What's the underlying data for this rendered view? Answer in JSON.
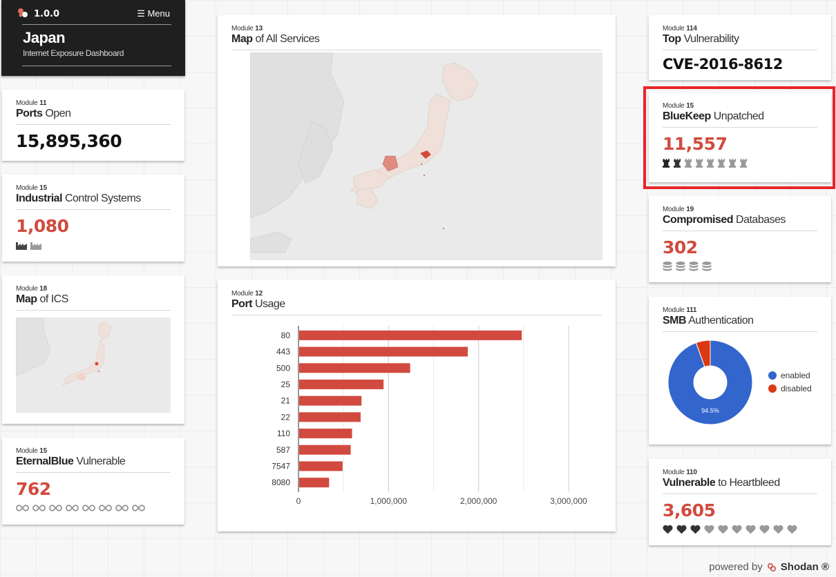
{
  "header": {
    "version": "1.0.0",
    "menu_label": "☰ Menu",
    "country": "Japan",
    "subtitle": "Internet Exposure Dashboard"
  },
  "cards": {
    "ports": {
      "module_word": "Module",
      "module_num": "11",
      "title_bold": "Ports",
      "title_rest": " Open",
      "value": "15,895,360"
    },
    "ics": {
      "module_word": "Module",
      "module_num": "15",
      "title_bold": "Industrial",
      "title_rest": " Control Systems",
      "value": "1,080",
      "icon_name": "factory-icon",
      "icon_count": 2
    },
    "ics_map": {
      "module_word": "Module",
      "module_num": "18",
      "title_bold": "Map",
      "title_rest": " of ICS"
    },
    "eternalblue": {
      "module_word": "Module",
      "module_num": "15",
      "title_bold": "EternalBlue",
      "title_rest": " Vulnerable",
      "value": "762",
      "icon_name": "infinity-icon",
      "icon_count": 8
    },
    "services_map": {
      "module_word": "Module",
      "module_num": "13",
      "title_bold": "Map",
      "title_rest": " of All Services"
    },
    "port_usage": {
      "module_word": "Module",
      "module_num": "12",
      "title_bold": "Port",
      "title_rest": " Usage"
    },
    "top_vuln": {
      "module_word": "Module",
      "module_num": "114",
      "title_bold": "Top",
      "title_rest": " Vulnerability",
      "value": "CVE-2016-8612"
    },
    "bluekeep": {
      "module_word": "Module",
      "module_num": "15",
      "title_bold": "BlueKeep",
      "title_rest": " Unpatched",
      "value": "11,557",
      "icon_name": "rook-icon",
      "icon_count": 8,
      "icon_active": 2
    },
    "databases": {
      "module_word": "Module",
      "module_num": "19",
      "title_bold": "Compromised",
      "title_rest": " Databases",
      "value": "302",
      "icon_name": "database-icon",
      "icon_count": 4
    },
    "smb": {
      "module_word": "Module",
      "module_num": "111",
      "title_bold": "SMB",
      "title_rest": " Authentication",
      "legend_enabled": "enabled",
      "legend_disabled": "disabled",
      "pct_label": "94.5%"
    },
    "heartbleed": {
      "module_word": "Module",
      "module_num": "110",
      "title_bold": "Vulnerable",
      "title_rest": " to Heartbleed",
      "value": "3,605",
      "icon_name": "heart-icon",
      "icon_count": 10,
      "icon_active": 3
    }
  },
  "chart_data": [
    {
      "type": "bar",
      "orientation": "horizontal",
      "categories": [
        "80",
        "443",
        "500",
        "25",
        "21",
        "22",
        "110",
        "587",
        "7547",
        "8080"
      ],
      "values": [
        2480000,
        1880000,
        1240000,
        945000,
        700000,
        690000,
        595000,
        580000,
        490000,
        340000
      ],
      "xlim": [
        0,
        3000000
      ],
      "xticks": [
        "0",
        "1,000,000",
        "2,000,000",
        "3,000,000"
      ],
      "grid": true,
      "color": "#d24a3f"
    },
    {
      "type": "pie",
      "donut": true,
      "labels": [
        "enabled",
        "disabled"
      ],
      "values": [
        94.5,
        5.5
      ],
      "colors": [
        "#3366cc",
        "#dc3912"
      ],
      "data_label": "94.5%",
      "legend": "right"
    }
  ],
  "footer": {
    "powered_by": "powered by",
    "brand": "Shodan ®"
  },
  "colors": {
    "accent": "#d24a3f",
    "header_bg": "#1f1f1f",
    "highlight": "#e8252a"
  }
}
